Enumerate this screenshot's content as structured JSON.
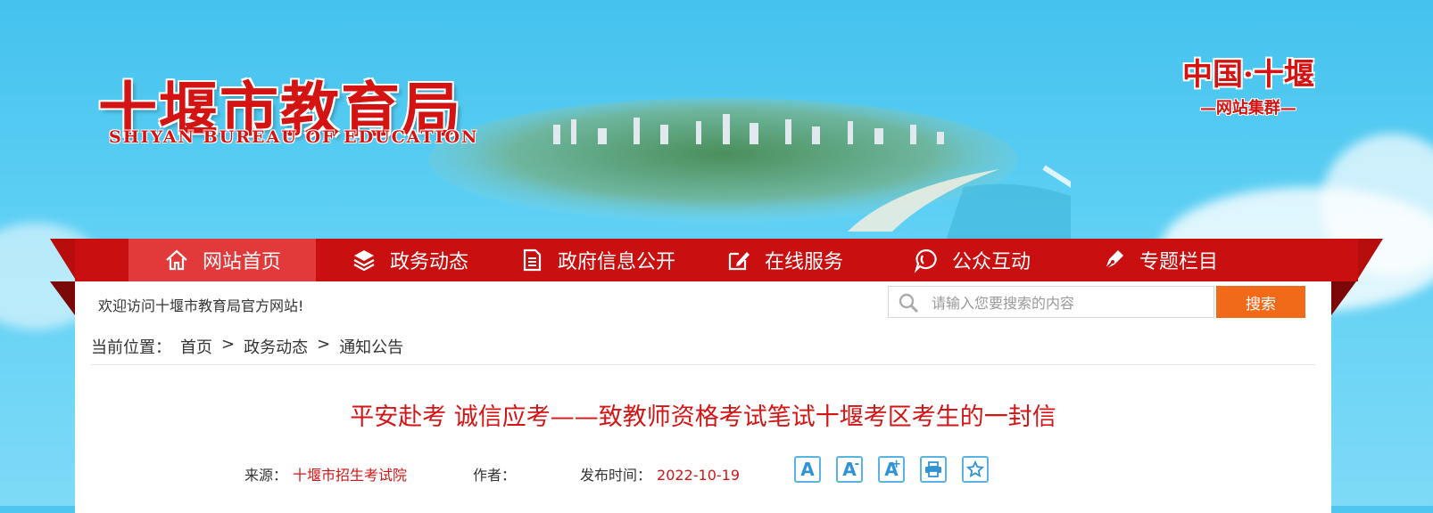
{
  "header": {
    "logo_cn": "十堰市教育局",
    "logo_en": "SHIYAN BUREAU OF EDUCATION",
    "cluster_title": "中国·十堰",
    "cluster_sub": "—网站集群—"
  },
  "nav": {
    "items": [
      {
        "label": "网站首页",
        "icon": "home-icon",
        "active": true
      },
      {
        "label": "政务动态",
        "icon": "layers-icon"
      },
      {
        "label": "政府信息公开",
        "icon": "document-icon"
      },
      {
        "label": "在线服务",
        "icon": "edit-icon"
      },
      {
        "label": "公众互动",
        "icon": "chat-icon"
      },
      {
        "label": "专题栏目",
        "icon": "pen-icon"
      }
    ]
  },
  "toolbar": {
    "welcome": "欢迎访问十堰市教育局官方网站!",
    "search_placeholder": "请输入您要搜索的内容",
    "search_button": "搜索"
  },
  "breadcrumb": {
    "prefix": "当前位置：",
    "items": [
      "首页",
      "政务动态",
      "通知公告"
    ],
    "separator": ">"
  },
  "article": {
    "title": "平安赴考 诚信应考——致教师资格考试笔试十堰考区考生的一封信",
    "source_label": "来源：",
    "source": "十堰市招生考试院",
    "author_label": "作者：",
    "author": "",
    "date_label": "发布时间：",
    "date": "2022-10-19"
  },
  "tools": {
    "font_normal": "A",
    "font_smaller": "A",
    "font_smaller_mark": "-",
    "font_larger": "A",
    "font_larger_mark": "+"
  },
  "colors": {
    "nav_red": "#c90f0f",
    "accent_red": "#d31515",
    "search_orange": "#f06a1a",
    "tool_blue": "#2f93d4"
  }
}
